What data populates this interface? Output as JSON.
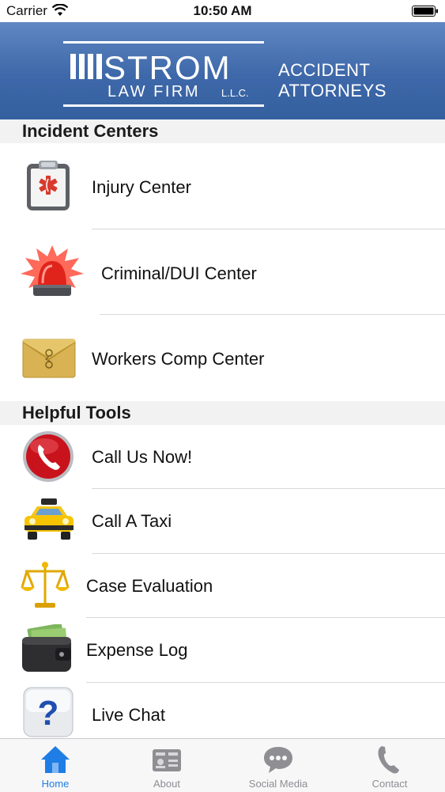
{
  "status_bar": {
    "carrier": "Carrier",
    "time": "10:50 AM"
  },
  "header": {
    "logo_name": "STROM",
    "logo_sub": "LAW FIRM",
    "logo_llc": "L.L.C.",
    "tagline_line1": "ACCIDENT",
    "tagline_line2": "ATTORNEYS"
  },
  "sections": {
    "incident": {
      "title": "Incident Centers",
      "items": [
        {
          "label": "Injury Center",
          "icon": "clipboard-medical-icon"
        },
        {
          "label": "Criminal/DUI Center",
          "icon": "siren-icon"
        },
        {
          "label": "Workers Comp Center",
          "icon": "envelope-icon"
        }
      ]
    },
    "tools": {
      "title": "Helpful Tools",
      "items": [
        {
          "label": "Call Us Now!",
          "icon": "phone-icon"
        },
        {
          "label": "Call A Taxi",
          "icon": "taxi-icon"
        },
        {
          "label": "Case Evaluation",
          "icon": "scales-icon"
        },
        {
          "label": "Expense Log",
          "icon": "wallet-icon"
        },
        {
          "label": "Live Chat",
          "icon": "question-icon"
        }
      ]
    }
  },
  "tab_bar": {
    "tabs": [
      {
        "label": "Home",
        "icon": "home-icon",
        "active": true
      },
      {
        "label": "About",
        "icon": "id-card-icon",
        "active": false
      },
      {
        "label": "Social Media",
        "icon": "chat-bubble-icon",
        "active": false
      },
      {
        "label": "Contact",
        "icon": "phone-handset-icon",
        "active": false
      }
    ]
  },
  "colors": {
    "header_blue": "#3e68a9",
    "tab_active": "#1f7de6",
    "tab_inactive": "#8e8e93",
    "section_bg": "#f2f2f3"
  }
}
